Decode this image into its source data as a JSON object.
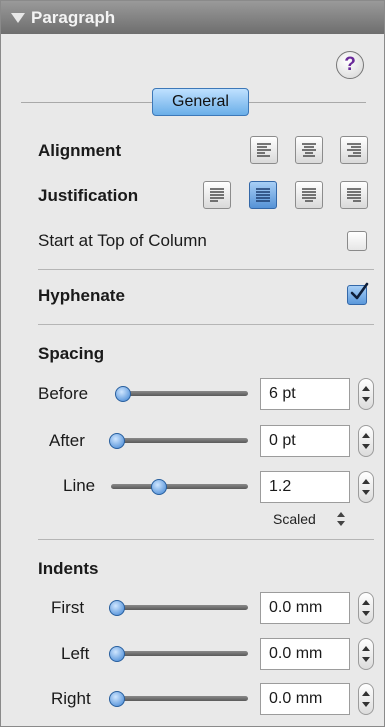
{
  "panel": {
    "title": "Paragraph"
  },
  "help": {
    "label": "?"
  },
  "tab": {
    "label": "General"
  },
  "alignment": {
    "label": "Alignment",
    "options": [
      "left-align",
      "center-align",
      "right-align"
    ],
    "selected": ""
  },
  "justification": {
    "label": "Justification",
    "options": [
      "justify-left",
      "justify-full",
      "justify-center",
      "justify-right"
    ],
    "selected": "justify-full"
  },
  "start_top_column": {
    "label": "Start at Top of Column",
    "checked": false
  },
  "hyphenate": {
    "label": "Hyphenate",
    "checked": true
  },
  "spacing": {
    "header": "Spacing",
    "before": {
      "label": "Before",
      "value": "6 pt"
    },
    "after": {
      "label": "After",
      "value": "0 pt"
    },
    "line": {
      "label": "Line",
      "value": "1.2",
      "mode": "Scaled"
    }
  },
  "indents": {
    "header": "Indents",
    "first": {
      "label": "First",
      "value": "0.0 mm"
    },
    "left": {
      "label": "Left",
      "value": "0.0 mm"
    },
    "right": {
      "label": "Right",
      "value": "0.0 mm"
    }
  },
  "colors": {
    "accent": "#5b98db",
    "title_bar": "#7a7a7a",
    "panel_bg": "#e9e9e9"
  }
}
